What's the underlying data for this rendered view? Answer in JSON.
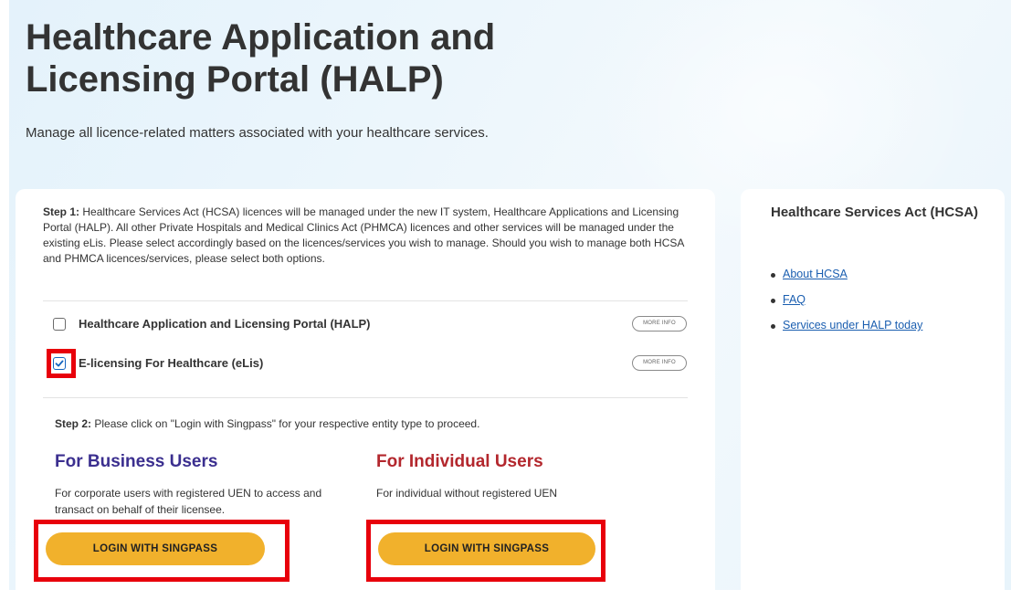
{
  "hero": {
    "title": "Healthcare Application and Licensing Portal (HALP)",
    "subtitle": "Manage all licence-related matters associated with your healthcare services."
  },
  "step1": {
    "label": "Step 1:",
    "text": " Healthcare Services Act (HCSA) licences will be managed under the new IT system, Healthcare Applications and Licensing Portal (HALP). All other Private Hospitals and Medical Clinics Act (PHMCA) licences and other services will be managed under the existing eLis. Please select accordingly based on the licences/services you wish to manage. Should you wish to manage both HCSA and PHMCA licences/services, please select both options."
  },
  "options": [
    {
      "label": "Healthcare Application and Licensing Portal (HALP)",
      "more_info": "MORE INFO",
      "checked": false
    },
    {
      "label": "E-licensing For Healthcare (eLis)",
      "more_info": "MORE INFO",
      "checked": true
    }
  ],
  "step2": {
    "label": "Step 2:",
    "text": " Please click on \"Login with Singpass\" for your respective entity type to proceed."
  },
  "business": {
    "heading": "For Business Users",
    "description": "For corporate users with registered UEN to access and transact on behalf of their licensee.",
    "button": "LOGIN WITH SINGPASS",
    "color": "#3b2f8f"
  },
  "individual": {
    "heading": "For Individual Users",
    "description": "For individual without registered UEN",
    "button": "LOGIN WITH SINGPASS",
    "color": "#b3272d"
  },
  "sidebar": {
    "title": "Healthcare Services Act (HCSA)",
    "links": [
      "About HCSA",
      "FAQ",
      "Services under HALP today"
    ]
  },
  "colors": {
    "button": "#f1b12c",
    "highlight": "#e8000b",
    "link": "#1a5eb0",
    "checkbox_checked": "#1565c0"
  }
}
